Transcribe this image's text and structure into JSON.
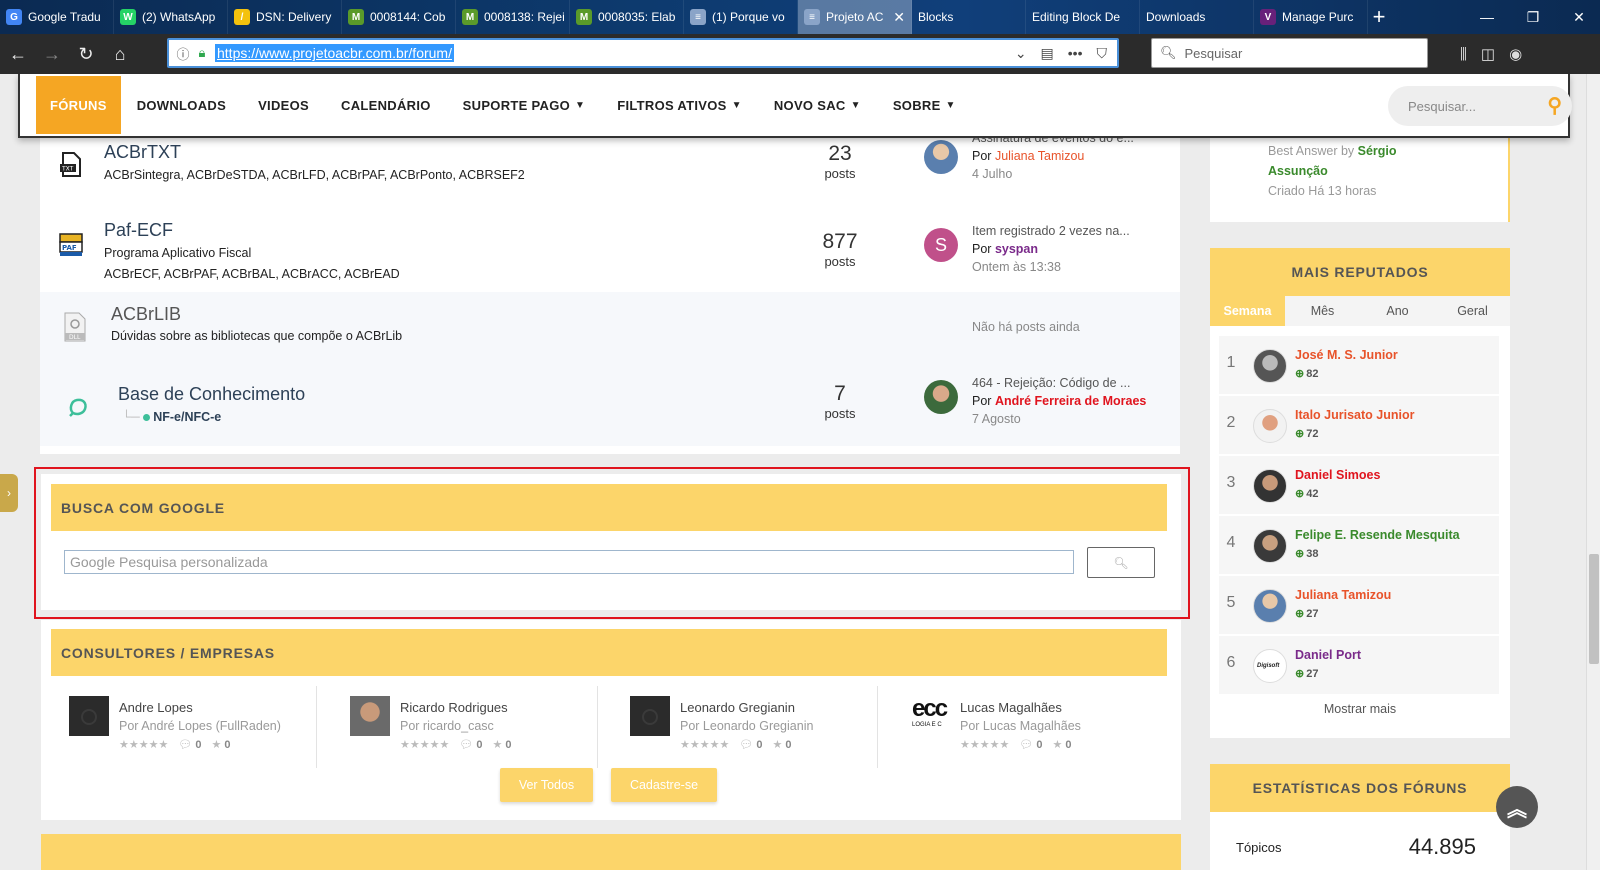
{
  "browser": {
    "tabs": [
      {
        "label": "Google Tradu",
        "icon": "google-translate-icon",
        "color": "#4285f4",
        "glyph": "G"
      },
      {
        "label": "(2) WhatsApp",
        "icon": "whatsapp-icon",
        "color": "#25d366",
        "glyph": "W"
      },
      {
        "label": "DSN: Delivery",
        "icon": "dsn-icon",
        "color": "#f4c20d",
        "glyph": "/"
      },
      {
        "label": "0008144: Cob",
        "icon": "mantis-icon",
        "color": "#5a9a2a",
        "glyph": "M"
      },
      {
        "label": "0008138: Rejei",
        "icon": "mantis-icon",
        "color": "#5a9a2a",
        "glyph": "M"
      },
      {
        "label": "0008035: Elab",
        "icon": "mantis-icon",
        "color": "#5a9a2a",
        "glyph": "M"
      },
      {
        "label": "(1) Porque vo",
        "icon": "page-icon",
        "color": "#8aa4c8",
        "glyph": "≡"
      },
      {
        "label": "Projeto AC",
        "icon": "page-icon",
        "color": "#8aa4c8",
        "glyph": "≡"
      },
      {
        "label": "Blocks",
        "icon": "blank-icon",
        "color": "transparent",
        "glyph": ""
      },
      {
        "label": "Editing Block De",
        "icon": "blank-icon",
        "color": "transparent",
        "glyph": ""
      },
      {
        "label": "Downloads",
        "icon": "blank-icon",
        "color": "transparent",
        "glyph": ""
      },
      {
        "label": "Manage Purc",
        "icon": "visual-studio-icon",
        "color": "#68217a",
        "glyph": "V"
      }
    ],
    "url": "https://www.projetoacbr.com.br/forum/",
    "search_placeholder": "Pesquisar"
  },
  "site_menu": {
    "items": [
      {
        "label": "FÓRUNS",
        "dropdown": false,
        "active": true
      },
      {
        "label": "DOWNLOADS",
        "dropdown": false,
        "active": false
      },
      {
        "label": "VIDEOS",
        "dropdown": false,
        "active": false
      },
      {
        "label": "CALENDÁRIO",
        "dropdown": false,
        "active": false
      },
      {
        "label": "SUPORTE PAGO",
        "dropdown": true,
        "active": false
      },
      {
        "label": "FILTROS ATIVOS",
        "dropdown": true,
        "active": false
      },
      {
        "label": "NOVO SAC",
        "dropdown": true,
        "active": false
      },
      {
        "label": "SOBRE",
        "dropdown": true,
        "active": false
      }
    ],
    "search_placeholder": "Pesquisar..."
  },
  "forums": [
    {
      "title": "ACBrTXT",
      "desc1": "ACBrSintegra, ACBrDeSTDA, ACBrLFD, ACBrPAF, ACBrPonto, ACBRSEF2",
      "desc2": "",
      "count": "23",
      "count_label": "posts",
      "last_title": "Assinatura de eventos do e...",
      "last_by_prefix": "Por",
      "last_by": "Juliana Tamizou",
      "last_by_color": "#e8532a",
      "last_date": "4 Julho",
      "icon": "txt-file-icon"
    },
    {
      "title": "Paf-ECF",
      "desc1": "Programa Aplicativo Fiscal",
      "desc2": "ACBrECF, ACBrPAF, ACBrBAL, ACBrACC, ACBrEAD",
      "count": "877",
      "count_label": "posts",
      "last_title": "Item registrado 2 vezes na...",
      "last_by_prefix": "Por",
      "last_by": "syspan",
      "last_by_color": "#7a2a8a",
      "last_date": "Ontem às 13:38",
      "icon": "paf-icon",
      "avatar_letter": "S"
    },
    {
      "title": "ACBrLIB",
      "desc1": "Dúvidas sobre as bibliotecas que compõe o ACBrLib",
      "desc2": "",
      "empty_text": "Não há posts ainda",
      "icon": "dll-file-icon"
    },
    {
      "title": "Base de Conhecimento",
      "desc1": "NF-e/NFC-e",
      "desc2": "",
      "count": "7",
      "count_label": "posts",
      "last_title": "464 - Rejeição: Código de ...",
      "last_by_prefix": "Por",
      "last_by": "André Ferreira de Moraes",
      "last_by_color": "#e0141e",
      "last_date": "7 Agosto",
      "icon": "knowledge-base-icon"
    }
  ],
  "google_search": {
    "title": "BUSCA COM GOOGLE",
    "placeholder": "Google Pesquisa personalizada",
    "button_icon": "search-icon"
  },
  "consultants": {
    "title": "CONSULTORES / EMPRESAS",
    "items": [
      {
        "name": "Andre Lopes",
        "by": "Por André Lopes (FullRaden)",
        "comments": "0",
        "stars": "0",
        "avatar": "camera-placeholder"
      },
      {
        "name": "Ricardo Rodrigues",
        "by": "Por ricardo_casc",
        "comments": "0",
        "stars": "0",
        "avatar": "photo"
      },
      {
        "name": "Leonardo Gregianin",
        "by": "Por Leonardo Gregianin",
        "comments": "0",
        "stars": "0",
        "avatar": "camera-placeholder"
      },
      {
        "name": "Lucas Magalhães",
        "by": "Por Lucas Magalhães",
        "comments": "0",
        "stars": "0",
        "avatar": "logo"
      }
    ],
    "logo_text": "ecc",
    "logo_sub": "LOGIA E C",
    "view_all": "Ver Todos",
    "register": "Cadastre-se",
    "rating_stars": "★★★★★"
  },
  "sidebar": {
    "best_answer_prefix": "Best Answer by",
    "best_answer_name_1": "Sérgio",
    "best_answer_name_2": "Assunção",
    "created": "Criado Há 13 horas",
    "reputation": {
      "title": "MAIS REPUTADOS",
      "tabs": [
        {
          "label": "Semana",
          "active": true
        },
        {
          "label": "Mês",
          "active": false
        },
        {
          "label": "Ano",
          "active": false
        },
        {
          "label": "Geral",
          "active": false
        }
      ],
      "rows": [
        {
          "rank": "1",
          "name": "José M. S. Junior",
          "points": "82",
          "color": "#e8532a"
        },
        {
          "rank": "2",
          "name": "Italo Jurisato Junior",
          "points": "72",
          "color": "#e8532a"
        },
        {
          "rank": "3",
          "name": "Daniel Simoes",
          "points": "42",
          "color": "#e0141e"
        },
        {
          "rank": "4",
          "name": "Felipe E. Resende Mesquita",
          "points": "38",
          "color": "#3a8a2c"
        },
        {
          "rank": "5",
          "name": "Juliana Tamizou",
          "points": "27",
          "color": "#e8532a"
        },
        {
          "rank": "6",
          "name": "Daniel Port",
          "points": "27",
          "color": "#7a2a8a"
        }
      ],
      "more": "Mostrar mais",
      "logo_text": "Digisoft"
    },
    "stats": {
      "title": "ESTATÍSTICAS DOS FÓRUNS",
      "label": "Tópicos",
      "value": "44.895"
    }
  }
}
